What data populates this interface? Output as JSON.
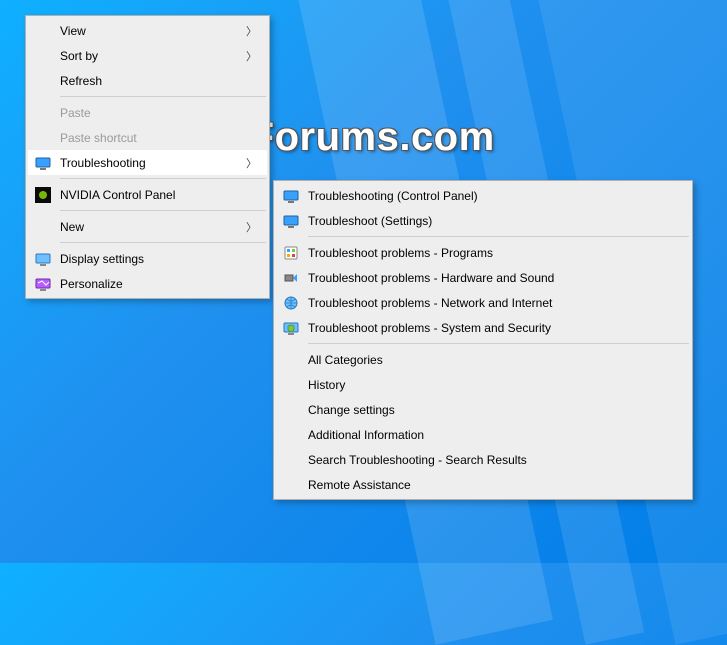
{
  "watermark": "TenForums.com",
  "mainMenu": {
    "view": {
      "label": "View"
    },
    "sortBy": {
      "label": "Sort by"
    },
    "refresh": {
      "label": "Refresh"
    },
    "paste": {
      "label": "Paste"
    },
    "pasteShortcut": {
      "label": "Paste shortcut"
    },
    "troubleshooting": {
      "label": "Troubleshooting"
    },
    "nvidia": {
      "label": "NVIDIA Control Panel"
    },
    "new": {
      "label": "New"
    },
    "displaySettings": {
      "label": "Display settings"
    },
    "personalize": {
      "label": "Personalize"
    }
  },
  "subMenu": {
    "cp": {
      "label": "Troubleshooting (Control Panel)"
    },
    "settings": {
      "label": "Troubleshoot (Settings)"
    },
    "programs": {
      "label": "Troubleshoot problems - Programs"
    },
    "hardware": {
      "label": "Troubleshoot problems - Hardware and Sound"
    },
    "network": {
      "label": "Troubleshoot problems - Network and Internet"
    },
    "system": {
      "label": "Troubleshoot problems - System and Security"
    },
    "allCategories": {
      "label": "All Categories"
    },
    "history": {
      "label": "History"
    },
    "changeSettings": {
      "label": "Change settings"
    },
    "additionalInfo": {
      "label": "Additional Information"
    },
    "search": {
      "label": "Search Troubleshooting - Search Results"
    },
    "remote": {
      "label": "Remote Assistance"
    }
  }
}
